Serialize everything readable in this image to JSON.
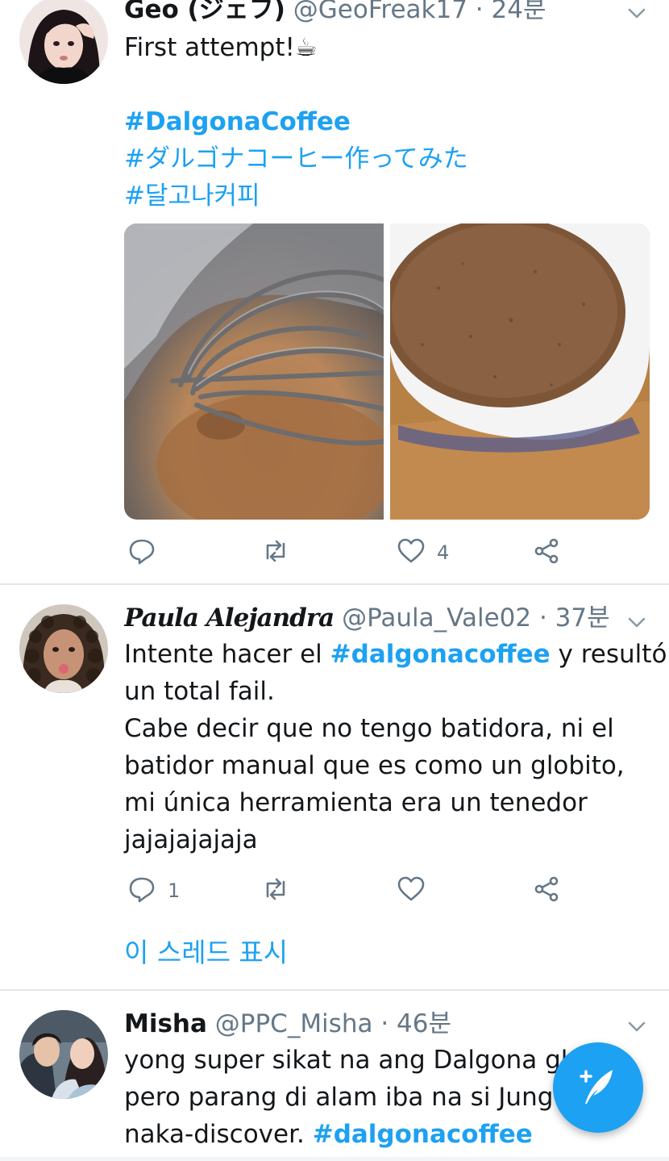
{
  "tweets": [
    {
      "name": "Geo (ジェフ)",
      "handle": "@GeoFreak17",
      "separator": "·",
      "time": "24분",
      "lines": [
        {
          "text": "First attempt!☕"
        },
        {
          "text": ""
        },
        {
          "text": "#DalgonaCoffee",
          "hashtag": true
        },
        {
          "text": "#ダルゴナコーヒー作ってみた",
          "hashtag": true
        },
        {
          "text": "#달고나커피",
          "hashtag": true
        }
      ],
      "media": [
        "whisk-in-bowl-image",
        "coffee-cup-image"
      ],
      "actions": {
        "reply": "",
        "retweet": "",
        "like": "4"
      }
    },
    {
      "name": "Paula Alejandra",
      "handle": "@Paula_Vale02",
      "separator": "·",
      "time": "37분",
      "line1_before": "Intente hacer el ",
      "line1_hashtag": "#dalgonacoffee",
      "line1_after": " y resultó",
      "lines": [
        "un total fail.",
        "Cabe decir que no tengo batidora, ni el",
        "batidor manual que es como un globito,",
        "mi única herramienta era un tenedor",
        "jajajajajaja"
      ],
      "actions": {
        "reply": "1",
        "retweet": "",
        "like": ""
      },
      "show_thread": "이 스레드 표시"
    },
    {
      "name": "Misha",
      "handle": "@PPC_Misha",
      "separator": "·",
      "time": "46분",
      "lines": [
        "yong super sikat na ang Dalgona gl",
        "pero parang di alam iba na si Jung"
      ],
      "line3_before": "naka-discover. ",
      "line3_hashtag": "#dalgonacoffee"
    }
  ],
  "fab": {
    "icon": "compose-tweet-icon"
  },
  "colors": {
    "accent": "#1da1f2",
    "secondary_text": "#657786",
    "divider": "#e1e8ed"
  }
}
